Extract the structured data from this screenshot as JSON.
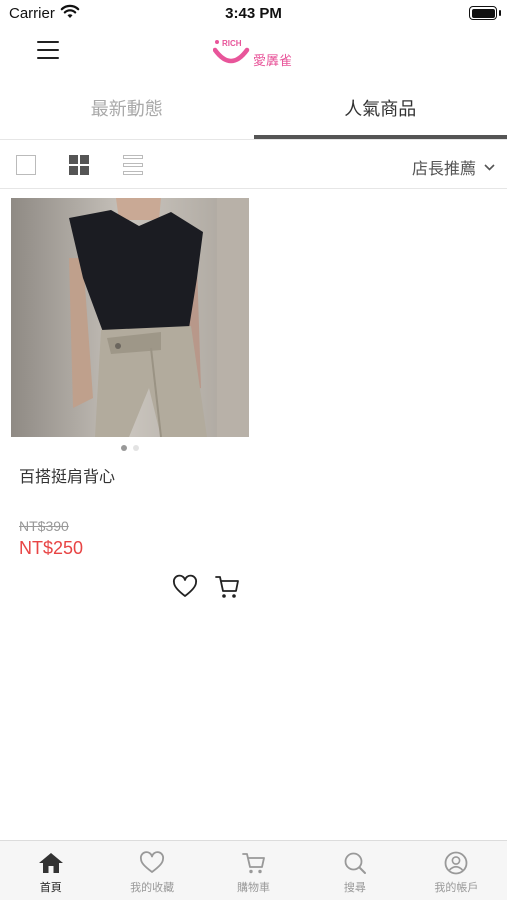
{
  "status_bar": {
    "carrier": "Carrier",
    "time": "3:43 PM"
  },
  "header": {
    "logo_badge": "RICH",
    "logo_text": "愛羼雀",
    "brand_color": "#e8559a"
  },
  "tabs": [
    {
      "label": "最新動態",
      "active": false
    },
    {
      "label": "人氣商品",
      "active": true
    }
  ],
  "toolbar": {
    "sort_label": "店長推薦"
  },
  "product": {
    "name": "百搭挺肩背心",
    "price_original": "NT$390",
    "price_sale": "NT$250",
    "sale_color": "#e84444",
    "image_pages": 2,
    "image_page_active": 1
  },
  "bottom_nav": [
    {
      "label": "首頁",
      "icon": "home-icon",
      "active": true
    },
    {
      "label": "我的收藏",
      "icon": "heart-icon",
      "active": false
    },
    {
      "label": "購物車",
      "icon": "cart-icon",
      "active": false
    },
    {
      "label": "搜尋",
      "icon": "search-icon",
      "active": false
    },
    {
      "label": "我的帳戶",
      "icon": "account-icon",
      "active": false
    }
  ]
}
